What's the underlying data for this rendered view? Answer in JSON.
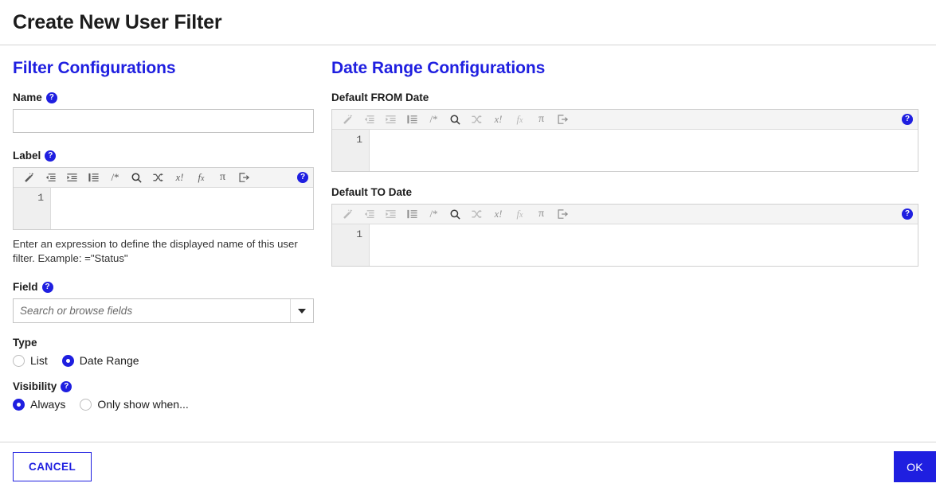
{
  "dialog": {
    "title": "Create New User Filter"
  },
  "left": {
    "section_title": "Filter Configurations",
    "name": {
      "label": "Name",
      "help": "?",
      "value": "",
      "placeholder": ""
    },
    "label_field": {
      "label": "Label",
      "help": "?",
      "line_number": "1",
      "code": "",
      "helper_text": "Enter an expression to define the displayed name of this user filter. Example: =\"Status\""
    },
    "field": {
      "label": "Field",
      "help": "?",
      "value": "",
      "placeholder": "Search or browse fields"
    },
    "type": {
      "label": "Type",
      "options": [
        {
          "label": "List",
          "selected": false
        },
        {
          "label": "Date Range",
          "selected": true
        }
      ]
    },
    "visibility": {
      "label": "Visibility",
      "help": "?",
      "options": [
        {
          "label": "Always",
          "selected": true
        },
        {
          "label": "Only show when...",
          "selected": false
        }
      ]
    }
  },
  "right": {
    "section_title": "Date Range Configurations",
    "from": {
      "label": "Default FROM Date",
      "line_number": "1",
      "code": ""
    },
    "to": {
      "label": "Default TO Date",
      "line_number": "1",
      "code": ""
    }
  },
  "toolbar": {
    "help": "?",
    "buttons": [
      {
        "name": "magic-wand-icon",
        "title": "Magic wand"
      },
      {
        "name": "outdent-icon",
        "title": "Outdent"
      },
      {
        "name": "indent-icon",
        "title": "Indent"
      },
      {
        "name": "format-list-icon",
        "title": "Format"
      },
      {
        "name": "comment-icon",
        "title": "Comment",
        "text": "/*"
      },
      {
        "name": "search-icon",
        "title": "Search"
      },
      {
        "name": "shuffle-icon",
        "title": "Swap"
      },
      {
        "name": "variable-icon",
        "title": "Variable",
        "text": "x!"
      },
      {
        "name": "function-icon",
        "title": "Function",
        "text": "fx"
      },
      {
        "name": "pi-icon",
        "title": "Constant",
        "text": "π"
      },
      {
        "name": "export-icon",
        "title": "Open in editor"
      }
    ]
  },
  "footer": {
    "cancel_label": "CANCEL",
    "ok_label": "OK"
  },
  "colors": {
    "accent": "#1f1fe0",
    "toolbar_bg": "#f4f4f4",
    "gutter_bg": "#efefef",
    "border": "#d0d0d0"
  }
}
